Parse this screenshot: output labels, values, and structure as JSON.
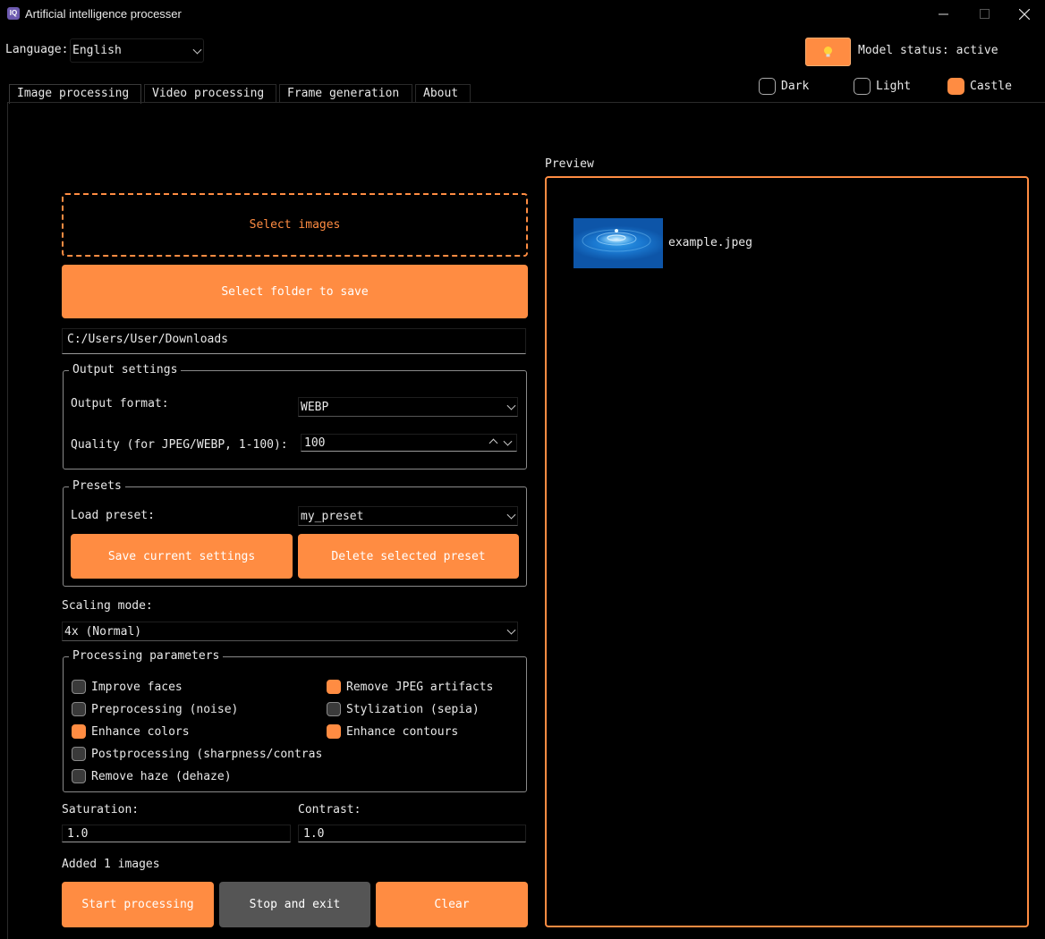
{
  "window": {
    "title": "Artificial intelligence processer",
    "icon_text": "IQ"
  },
  "language": {
    "label": "Language:",
    "value": "English"
  },
  "model": {
    "button_icon": "lightbulb-icon",
    "status": "Model status: active"
  },
  "tabs": [
    {
      "label": "Image processing",
      "active": true
    },
    {
      "label": "Video processing"
    },
    {
      "label": "Frame generation"
    },
    {
      "label": "About"
    }
  ],
  "themes": [
    {
      "label": "Dark",
      "selected": false
    },
    {
      "label": "Light",
      "selected": false
    },
    {
      "label": "Castle",
      "selected": true
    }
  ],
  "main": {
    "select_images": "Select images",
    "select_folder": "Select folder to save",
    "save_path": "C:/Users/User/Downloads"
  },
  "output_settings": {
    "title": "Output settings",
    "format_label": "Output format:",
    "format_value": "WEBP",
    "quality_label": "Quality (for JPEG/WEBP, 1-100):",
    "quality_value": "100"
  },
  "presets": {
    "title": "Presets",
    "load_label": "Load preset:",
    "load_value": "my_preset",
    "save_button": "Save current settings",
    "delete_button": "Delete selected preset"
  },
  "scaling": {
    "label": "Scaling mode:",
    "value": "4x (Normal)"
  },
  "processing": {
    "title": "Processing parameters",
    "left": [
      {
        "label": "Improve faces",
        "checked": false
      },
      {
        "label": "Preprocessing (noise)",
        "checked": false
      },
      {
        "label": "Enhance colors",
        "checked": true
      },
      {
        "label": "Postprocessing (sharpness/contras",
        "checked": false
      },
      {
        "label": "Remove haze (dehaze)",
        "checked": false
      }
    ],
    "right": [
      {
        "label": "Remove JPEG artifacts",
        "checked": true
      },
      {
        "label": "Stylization (sepia)",
        "checked": false
      },
      {
        "label": "Enhance contours",
        "checked": true
      }
    ]
  },
  "adjust": {
    "saturation_label": "Saturation:",
    "saturation_value": "1.0",
    "contrast_label": "Contrast:",
    "contrast_value": "1.0"
  },
  "status_text": "Added 1 images",
  "actions": {
    "start": "Start processing",
    "stop": "Stop and exit",
    "clear": "Clear"
  },
  "preview": {
    "label": "Preview",
    "items": [
      {
        "name": "example.jpeg"
      }
    ]
  },
  "colors": {
    "accent": "#ff8c42",
    "stop_button": "#555555",
    "background": "#000000"
  }
}
